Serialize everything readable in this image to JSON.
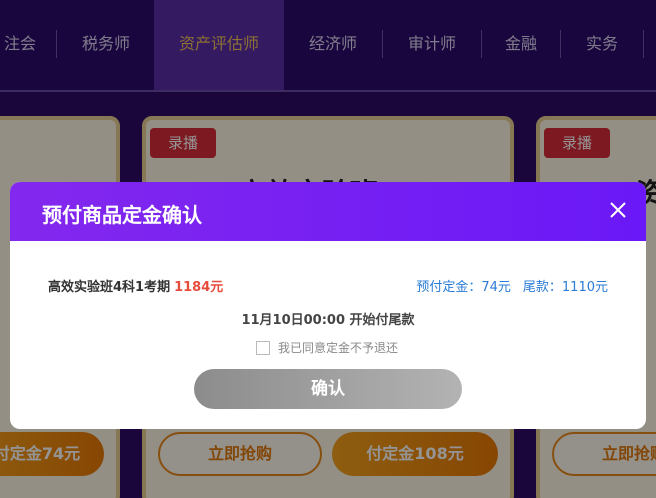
{
  "nav": {
    "items": [
      {
        "label": "注会"
      },
      {
        "label": "税务师"
      },
      {
        "label": "资产评估师"
      },
      {
        "label": "经济师"
      },
      {
        "label": "审计师"
      },
      {
        "label": "金融"
      },
      {
        "label": "实务"
      }
    ]
  },
  "cards": {
    "tag_label": "录播",
    "middle_title": "高效实验班",
    "right_title": "资",
    "left_button": "付定金74元",
    "middle_buy": "立即抢购",
    "middle_deposit": "付定金108元",
    "right_buy": "立即抢购"
  },
  "modal": {
    "title": "预付商品定金确认",
    "product_name": "高效实验班4科1考期",
    "product_price": "1184元",
    "deposit_text": "预付定金：74元",
    "balance_text": "尾款：1110元",
    "start_time": "11月10日00:00 开始付尾款",
    "agree_label": "我已同意定金不予退还",
    "confirm_label": "确认"
  },
  "colors": {
    "nav_bg": "#2c0b6b",
    "nav_active_bg": "#5a2ea8",
    "nav_active_text": "#f1c25a",
    "modal_header_start": "#8328ee",
    "modal_header_end": "#6a18f7",
    "price_red": "#e84c3d",
    "link_blue": "#2a7cd6",
    "confirm_gray": "#9e9e9e"
  }
}
